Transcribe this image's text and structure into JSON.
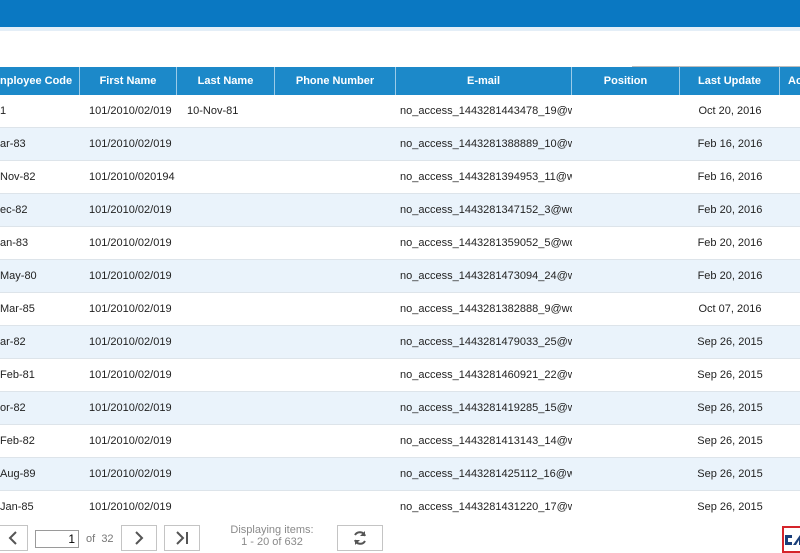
{
  "search": {
    "placeholder": "",
    "value": ""
  },
  "columns": [
    {
      "key": "code",
      "label": "nployee Code"
    },
    {
      "key": "first",
      "label": "First Name"
    },
    {
      "key": "last",
      "label": "Last Name"
    },
    {
      "key": "phone",
      "label": "Phone Number"
    },
    {
      "key": "email",
      "label": "E-mail"
    },
    {
      "key": "pos",
      "label": "Position"
    },
    {
      "key": "upd",
      "label": "Last Update"
    },
    {
      "key": "extra",
      "label": "Ac"
    }
  ],
  "rows": [
    {
      "code": "1",
      "first": "101/2010/02/019",
      "last": "10-Nov-81",
      "phone": "",
      "email": "no_access_1443281443478_19@w",
      "pos": "",
      "upd": "Oct 20, 2016"
    },
    {
      "code": "ar-83",
      "first": "101/2010/02/019",
      "last": "",
      "phone": "",
      "email": "no_access_1443281388889_10@w",
      "pos": "",
      "upd": "Feb 16, 2016"
    },
    {
      "code": "Nov-82",
      "first": "101/2010/020194",
      "last": "",
      "phone": "",
      "email": "no_access_1443281394953_11@w",
      "pos": "",
      "upd": "Feb 16, 2016"
    },
    {
      "code": "ec-82",
      "first": "101/2010/02/019",
      "last": "",
      "phone": "",
      "email": "no_access_1443281347152_3@wo",
      "pos": "",
      "upd": "Feb 20, 2016"
    },
    {
      "code": "an-83",
      "first": "101/2010/02/019",
      "last": "",
      "phone": "",
      "email": "no_access_1443281359052_5@wo",
      "pos": "",
      "upd": "Feb 20, 2016"
    },
    {
      "code": "May-80",
      "first": "101/2010/02/019",
      "last": "",
      "phone": "",
      "email": "no_access_1443281473094_24@w",
      "pos": "",
      "upd": "Feb 20, 2016"
    },
    {
      "code": "Mar-85",
      "first": "101/2010/02/019",
      "last": "",
      "phone": "",
      "email": "no_access_1443281382888_9@wo",
      "pos": "",
      "upd": "Oct 07, 2016"
    },
    {
      "code": "ar-82",
      "first": "101/2010/02/019",
      "last": "",
      "phone": "",
      "email": "no_access_1443281479033_25@w",
      "pos": "",
      "upd": "Sep 26, 2015"
    },
    {
      "code": "Feb-81",
      "first": "101/2010/02/019",
      "last": "",
      "phone": "",
      "email": "no_access_1443281460921_22@w",
      "pos": "",
      "upd": "Sep 26, 2015"
    },
    {
      "code": "or-82",
      "first": "101/2010/02/019",
      "last": "",
      "phone": "",
      "email": "no_access_1443281419285_15@w",
      "pos": "",
      "upd": "Sep 26, 2015"
    },
    {
      "code": "Feb-82",
      "first": "101/2010/02/019",
      "last": "",
      "phone": "",
      "email": "no_access_1443281413143_14@w",
      "pos": "",
      "upd": "Sep 26, 2015"
    },
    {
      "code": "Aug-89",
      "first": "101/2010/02/019",
      "last": "",
      "phone": "",
      "email": "no_access_1443281425112_16@w",
      "pos": "",
      "upd": "Sep 26, 2015"
    },
    {
      "code": "Jan-85",
      "first": "101/2010/02/019",
      "last": "",
      "phone": "",
      "email": "no_access_1443281431220_17@w",
      "pos": "",
      "upd": "Sep 26, 2015"
    }
  ],
  "pager": {
    "page": "1",
    "of_label": "of",
    "total_pages": "32",
    "displaying_label": "Displaying items:",
    "range": "1 - 20 of 632"
  },
  "colors": {
    "topbar": "#0a78c2",
    "header": "#1c89c9",
    "alt_row": "#eaf3fb",
    "logo_border": "#d5242a"
  },
  "icons": [
    "prev-page-icon",
    "next-page-icon",
    "last-page-icon",
    "refresh-icon",
    "brand-logo-icon"
  ]
}
